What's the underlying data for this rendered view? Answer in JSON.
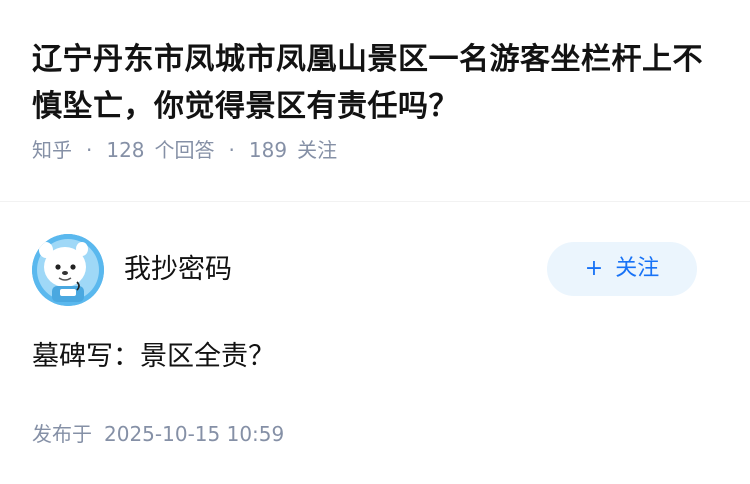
{
  "question": {
    "title": "辽宁丹东市凤城市凤凰山景区一名游客坐栏杆上不慎坠亡，你觉得景区有责任吗？",
    "source": "知乎",
    "answer_count": "128",
    "answer_label": "个回答",
    "follower_count": "189",
    "follower_label": "关注"
  },
  "answer": {
    "author_name": "我抄密码",
    "follow_label": "关注",
    "follow_plus": "+",
    "content": "墓碑写：景区全责？",
    "publish_label": "发布于",
    "publish_date": "2025-10-15 10:59"
  },
  "colors": {
    "title": "#121212",
    "meta": "#8590a6",
    "follow_bg": "#ebf5fd",
    "follow_text": "#1772f6",
    "avatar_bg": "#4fb0e8"
  },
  "icons": {
    "avatar": "cartoon-bear-astronaut-avatar"
  }
}
